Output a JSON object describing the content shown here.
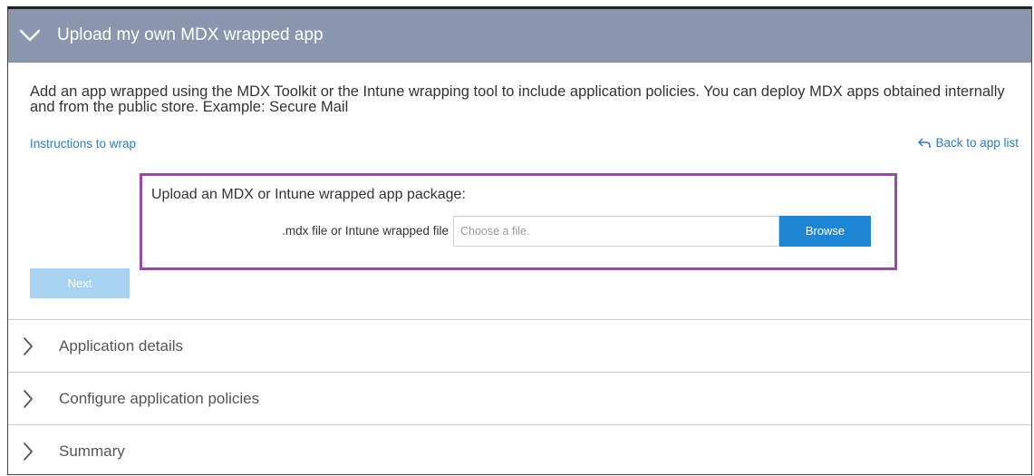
{
  "header": {
    "title": "Upload my own MDX wrapped app",
    "icon": "chevron-down-icon"
  },
  "description": "Add an app wrapped using the MDX Toolkit or the Intune wrapping tool to include application policies. You can deploy MDX apps obtained internally and from the public store. Example: Secure Mail",
  "links": {
    "instructions": "Instructions to wrap",
    "back": "Back to app list"
  },
  "upload": {
    "title": "Upload an MDX or Intune wrapped app package:",
    "field_label": ".mdx file or Intune wrapped file",
    "placeholder": "Choose a file.",
    "browse_label": "Browse"
  },
  "next_label": "Next",
  "sections": [
    {
      "label": "Application details"
    },
    {
      "label": "Configure application policies"
    },
    {
      "label": "Summary"
    }
  ],
  "colors": {
    "header_bg": "#8a96ad",
    "link": "#2a7fc4",
    "browse_bg": "#1f86d6",
    "next_bg_disabled": "#a6d3ef",
    "highlight_border": "#9a4aa8"
  }
}
